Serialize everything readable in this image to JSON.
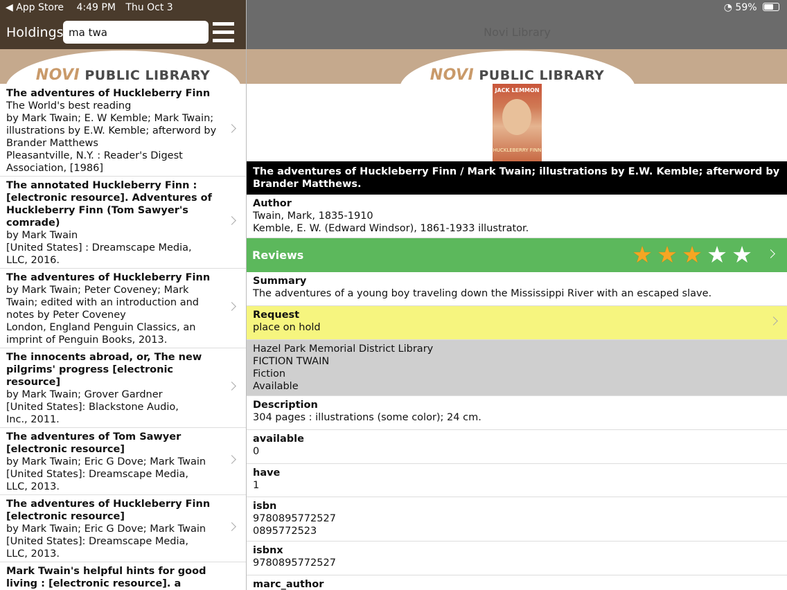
{
  "status_bar": {
    "back_app": "◀ App Store",
    "time": "4:49 PM",
    "date": "Thu Oct 3",
    "battery": "59%"
  },
  "left_header": {
    "title": "Holdings",
    "search_value": "ma twa"
  },
  "right_header": {
    "title": "Novi Library"
  },
  "banner": {
    "logo_novi": "NOVI",
    "logo_text": "PUBLIC LIBRARY"
  },
  "results": [
    {
      "title": "The adventures of Huckleberry Finn",
      "lines": [
        "The World's best reading",
        "by Mark Twain; E. W Kemble; Mark Twain;",
        "illustrations by E.W. Kemble; afterword by",
        "Brander Matthews",
        "Pleasantville, N.Y. : Reader's Digest",
        "Association, [1986]"
      ]
    },
    {
      "title": "The annotated Huckleberry Finn : [electronic resource]. Adventures of Huckleberry Finn (Tom Sawyer's comrade)",
      "lines": [
        "by Mark Twain",
        "[United States] : Dreamscape Media,",
        "LLC, 2016."
      ]
    },
    {
      "title": "The adventures of Huckleberry Finn",
      "lines": [
        "by Mark Twain; Peter Coveney; Mark",
        "Twain; edited with an introduction and",
        "notes by Peter Coveney",
        "London, England Penguin Classics, an",
        "imprint of Penguin Books, 2013."
      ]
    },
    {
      "title": "The innocents abroad, or, The new pilgrims' progress [electronic resource]",
      "lines": [
        "by Mark Twain; Grover Gardner",
        "[United States]: Blackstone Audio,",
        "Inc., 2011."
      ]
    },
    {
      "title": "The adventures of Tom Sawyer [electronic resource]",
      "lines": [
        "by Mark Twain; Eric G Dove; Mark Twain",
        "[United States]: Dreamscape Media,",
        "LLC, 2013."
      ]
    },
    {
      "title": "The adventures of Huckleberry Finn [electronic resource]",
      "lines": [
        "by Mark Twain; Eric G Dove; Mark Twain",
        "[United States]: Dreamscape Media,",
        "LLC, 2013."
      ]
    },
    {
      "title": "Mark Twain's helpful hints for good living : [electronic resource]. a",
      "lines": []
    }
  ],
  "cover": {
    "top_text": "JACK LEMMON",
    "bottom_text": "HUCKLEBERRY FINN"
  },
  "detail": {
    "title": "The adventures of Huckleberry Finn / Mark Twain; illustrations by E.W. Kemble; afterword by Brander Matthews.",
    "author_label": "Author",
    "author_1": "Twain, Mark, 1835-1910",
    "author_2": "Kemble, E. W. (Edward Windsor), 1861-1933 illustrator.",
    "reviews_label": "Reviews",
    "rating": 3,
    "rating_max": 5,
    "summary_label": "Summary",
    "summary": "The adventures of a young boy traveling down the Mississippi River with an escaped slave.",
    "request_label": "Request",
    "request_value": "place on hold",
    "holding_library": "Hazel Park Memorial District Library",
    "holding_call": "FICTION TWAIN",
    "holding_type": "Fiction",
    "holding_status": "Available",
    "description_label": "Description",
    "description": "304 pages : illustrations (some color); 24 cm.",
    "available_label": "available",
    "available_value": "0",
    "have_label": "have",
    "have_value": "1",
    "isbn_label": "isbn",
    "isbn_1": "9780895772527",
    "isbn_2": "0895772523",
    "isbnx_label": "isbnx",
    "isbnx_value": "9780895772527",
    "marc_author_label": "marc_author"
  },
  "colors": {
    "header_left": "#4a3b2c",
    "header_right": "#6b6b6b",
    "banner": "#c5a98d",
    "reviews": "#5cb85c",
    "request": "#f6f57f",
    "holding": "#cfcfcf",
    "star_on": "#f5a623"
  }
}
